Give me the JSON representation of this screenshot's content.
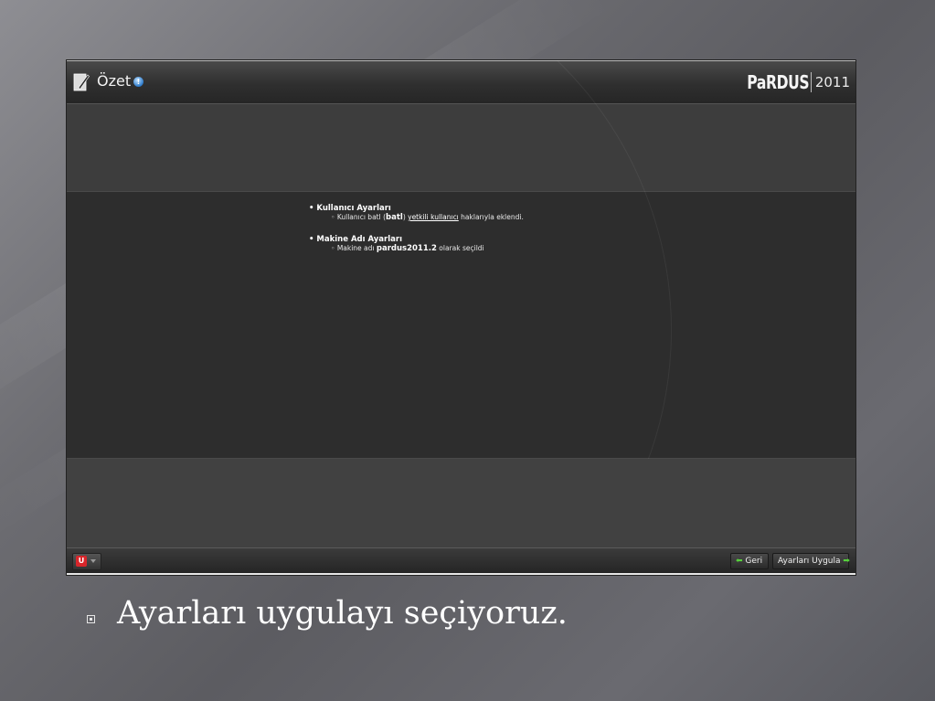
{
  "window": {
    "title": "Özet",
    "help_glyph": "!",
    "brand_logo": "PaRDUS",
    "brand_year": "2011"
  },
  "summary": {
    "sections": [
      {
        "heading": "Kullanıcı Ayarları",
        "detail_prefix": "Kullanıcı batl (",
        "detail_bold": "batl",
        "detail_mid": ") ",
        "detail_link": "yetkili kullanıcı",
        "detail_suffix": " haklarıyla eklendi."
      },
      {
        "heading": "Makine Adı Ayarları",
        "detail_prefix": "Makine adı ",
        "detail_bold": "pardus2011.2",
        "detail_suffix": " olarak seçildi"
      }
    ]
  },
  "bottombar": {
    "back_label": "Geri",
    "apply_label": "Ayarları Uygula"
  },
  "slide": {
    "caption": "Ayarları uygulayı seçiyoruz."
  },
  "colors": {
    "accent_green": "#56d13c",
    "system_red": "#d8262b",
    "help_blue": "#2b79c9"
  }
}
